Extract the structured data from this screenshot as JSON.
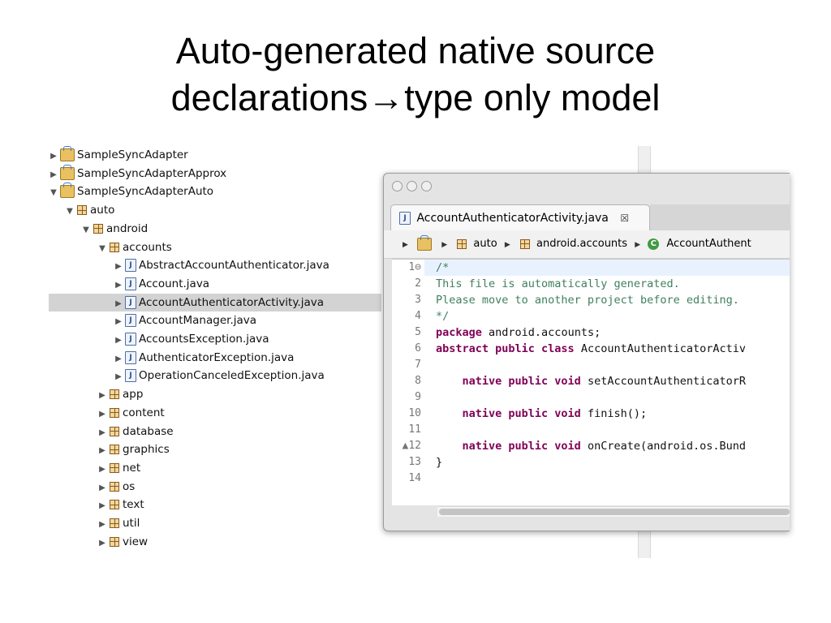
{
  "slide": {
    "title_line1": "Auto-generated native source",
    "title_line2": "declarations→type only model"
  },
  "explorer": {
    "items": [
      {
        "label": "SampleSyncAdapter",
        "icon": "project-icon",
        "twisty": "▶"
      },
      {
        "label": "SampleSyncAdapterApprox",
        "icon": "project-icon",
        "twisty": "▶"
      },
      {
        "label": "SampleSyncAdapterAuto",
        "icon": "project-icon",
        "twisty": "▼"
      },
      {
        "label": "auto",
        "icon": "package-icon",
        "twisty": "▼"
      },
      {
        "label": "android",
        "icon": "package-icon",
        "twisty": "▼"
      },
      {
        "label": "accounts",
        "icon": "package-icon",
        "twisty": "▼"
      },
      {
        "label": "AbstractAccountAuthenticator.java",
        "icon": "java-file-icon",
        "twisty": "▶"
      },
      {
        "label": "Account.java",
        "icon": "java-file-icon",
        "twisty": "▶"
      },
      {
        "label": "AccountAuthenticatorActivity.java",
        "icon": "java-file-icon",
        "twisty": "▶",
        "selected": true
      },
      {
        "label": "AccountManager.java",
        "icon": "java-file-icon",
        "twisty": "▶"
      },
      {
        "label": "AccountsException.java",
        "icon": "java-file-icon",
        "twisty": "▶"
      },
      {
        "label": "AuthenticatorException.java",
        "icon": "java-file-icon",
        "twisty": "▶"
      },
      {
        "label": "OperationCanceledException.java",
        "icon": "java-file-icon",
        "twisty": "▶"
      },
      {
        "label": "app",
        "icon": "package-icon",
        "twisty": "▶"
      },
      {
        "label": "content",
        "icon": "package-icon",
        "twisty": "▶"
      },
      {
        "label": "database",
        "icon": "package-icon",
        "twisty": "▶"
      },
      {
        "label": "graphics",
        "icon": "package-icon",
        "twisty": "▶"
      },
      {
        "label": "net",
        "icon": "package-icon",
        "twisty": "▶"
      },
      {
        "label": "os",
        "icon": "package-icon",
        "twisty": "▶"
      },
      {
        "label": "text",
        "icon": "package-icon",
        "twisty": "▶"
      },
      {
        "label": "util",
        "icon": "package-icon",
        "twisty": "▶"
      },
      {
        "label": "view",
        "icon": "package-icon",
        "twisty": "▶"
      }
    ]
  },
  "editor": {
    "tab_label": "AccountAuthenticatorActivity.java",
    "tab_close": "☒",
    "breadcrumbs": {
      "pkg_root": "auto",
      "pkg": "android.accounts",
      "cls_badge": "C",
      "cls": "AccountAuthent"
    },
    "lines": [
      {
        "num": "1⊖",
        "parts": [
          {
            "t": "/*",
            "c": "cmt"
          }
        ]
      },
      {
        "num": "2",
        "parts": [
          {
            "t": "This file is automatically generated.",
            "c": "cmt"
          }
        ]
      },
      {
        "num": "3",
        "parts": [
          {
            "t": "Please move to another project before editing.",
            "c": "cmt"
          }
        ]
      },
      {
        "num": "4",
        "parts": [
          {
            "t": "*/",
            "c": "cmt"
          }
        ]
      },
      {
        "num": "5",
        "parts": [
          {
            "t": "package",
            "c": "kw"
          },
          {
            "t": " android.accounts;",
            "c": ""
          }
        ]
      },
      {
        "num": "6",
        "parts": [
          {
            "t": "abstract public class",
            "c": "kw"
          },
          {
            "t": " AccountAuthenticatorActiv",
            "c": ""
          }
        ]
      },
      {
        "num": "7",
        "parts": []
      },
      {
        "num": "8",
        "parts": [
          {
            "t": "    ",
            "c": ""
          },
          {
            "t": "native public void",
            "c": "kw"
          },
          {
            "t": " setAccountAuthenticatorR",
            "c": ""
          }
        ]
      },
      {
        "num": "9",
        "parts": []
      },
      {
        "num": "10",
        "parts": [
          {
            "t": "    ",
            "c": ""
          },
          {
            "t": "native public void",
            "c": "kw"
          },
          {
            "t": " finish();",
            "c": ""
          }
        ]
      },
      {
        "num": "11",
        "parts": []
      },
      {
        "num": "▲12",
        "parts": [
          {
            "t": "    ",
            "c": ""
          },
          {
            "t": "native public void",
            "c": "kw"
          },
          {
            "t": " onCreate(android.os.Bund",
            "c": ""
          }
        ]
      },
      {
        "num": "13",
        "parts": [
          {
            "t": "}",
            "c": ""
          }
        ]
      },
      {
        "num": "14",
        "parts": []
      }
    ]
  }
}
